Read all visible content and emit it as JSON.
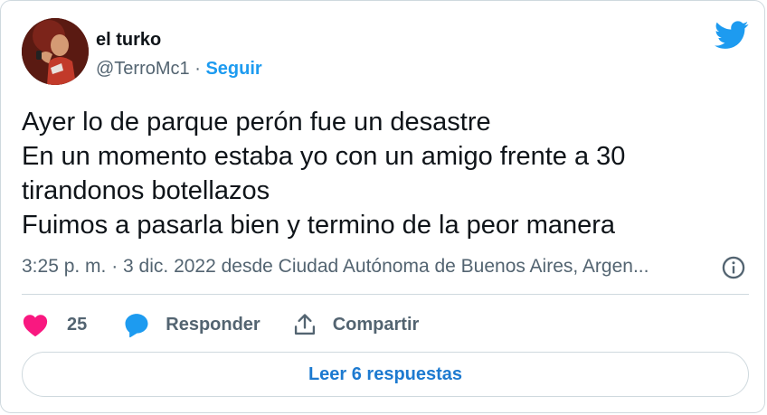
{
  "author": {
    "name": "el turko",
    "handle": "@TerroMc1",
    "separator": "·",
    "follow_label": "Seguir"
  },
  "tweet": {
    "lines": [
      "Ayer lo de parque perón fue un desastre",
      "En un momento estaba yo con un amigo frente a 30",
      "tirandonos botellazos",
      "Fuimos a pasarla bien y termino de la peor manera"
    ],
    "timestamp": "3:25 p. m. · 3 dic. 2022 desde Ciudad Autónoma de Buenos Aires, Argen..."
  },
  "actions": {
    "like_count": "25",
    "reply_label": "Responder",
    "share_label": "Compartir",
    "read_replies_label": "Leer 6 respuestas"
  },
  "colors": {
    "accent": "#1d9bf0",
    "like": "#f91880",
    "muted": "#536471",
    "border": "#cfd9de"
  },
  "icons": [
    "twitter-bird-icon",
    "info-icon",
    "heart-icon",
    "reply-bubble-icon",
    "share-icon"
  ]
}
